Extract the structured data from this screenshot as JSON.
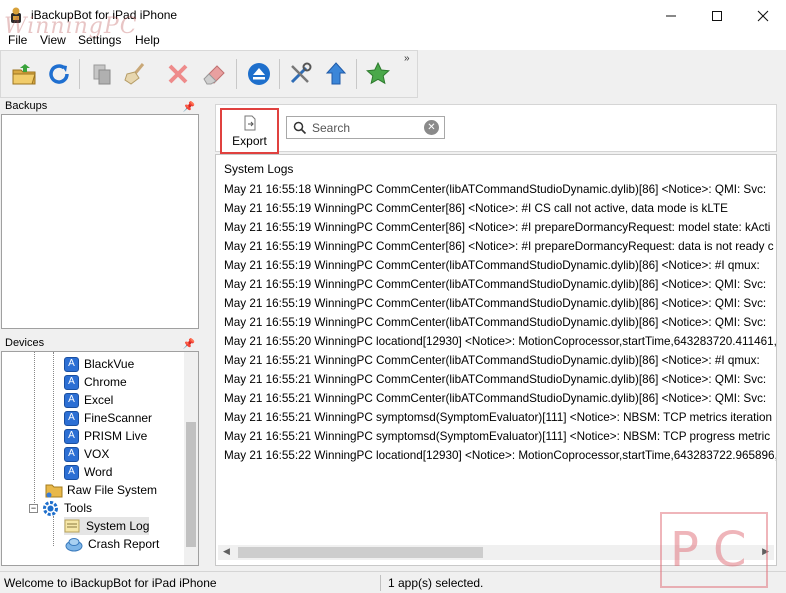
{
  "window": {
    "title": "iBackupBot for iPad iPhone"
  },
  "watermark": {
    "top": "WinningPC",
    "corner": "PC"
  },
  "menu": [
    "File",
    "View",
    "Settings",
    "Help"
  ],
  "toolbar": {
    "buttons": [
      "open-folder-icon",
      "refresh-icon",
      "copy-icon",
      "clean-icon",
      "delete-icon",
      "eraser-icon",
      "eject-icon",
      "tools-icon",
      "upload-icon",
      "star-icon"
    ],
    "overflow": "»"
  },
  "backups": {
    "header": "Backups"
  },
  "devices": {
    "header": "Devices",
    "apps": [
      "BlackVue",
      "Chrome",
      "Excel",
      "FineScanner",
      "PRISM Live",
      "VOX",
      "Word"
    ],
    "raw_file_system": "Raw File System",
    "tools": "Tools",
    "system_log": "System Log",
    "crash_report": "Crash Report"
  },
  "content": {
    "export_label": "Export",
    "search_placeholder": "Search",
    "logs_title": "System Logs",
    "logs": [
      "May 21 16:55:18 WinningPC CommCenter(libATCommandStudioDynamic.dylib)[86] <Notice>: QMI: Svc:",
      "May 21 16:55:19 WinningPC CommCenter[86] <Notice>: #I CS call not active, data mode is kLTE",
      "May 21 16:55:19 WinningPC CommCenter[86] <Notice>: #I prepareDormancyRequest: model state: kActi",
      "May 21 16:55:19 WinningPC CommCenter[86] <Notice>: #I prepareDormancyRequest: data is not ready c",
      "May 21 16:55:19 WinningPC CommCenter(libATCommandStudioDynamic.dylib)[86] <Notice>: #I qmux:",
      "May 21 16:55:19 WinningPC CommCenter(libATCommandStudioDynamic.dylib)[86] <Notice>: QMI: Svc:",
      "May 21 16:55:19 WinningPC CommCenter(libATCommandStudioDynamic.dylib)[86] <Notice>: QMI: Svc:",
      "May 21 16:55:19 WinningPC CommCenter(libATCommandStudioDynamic.dylib)[86] <Notice>: QMI: Svc:",
      "May 21 16:55:20 WinningPC locationd[12930] <Notice>: MotionCoprocessor,startTime,643283720.411461,",
      "May 21 16:55:21 WinningPC CommCenter(libATCommandStudioDynamic.dylib)[86] <Notice>: #I qmux:",
      "May 21 16:55:21 WinningPC CommCenter(libATCommandStudioDynamic.dylib)[86] <Notice>: QMI: Svc:",
      "May 21 16:55:21 WinningPC CommCenter(libATCommandStudioDynamic.dylib)[86] <Notice>: QMI: Svc:",
      "May 21 16:55:21 WinningPC symptomsd(SymptomEvaluator)[111] <Notice>: NBSM: TCP metrics iteration",
      "May 21 16:55:21 WinningPC symptomsd(SymptomEvaluator)[111] <Notice>: NBSM: TCP progress metric",
      "May 21 16:55:22 WinningPC locationd[12930] <Notice>: MotionCoprocessor,startTime,643283722.965896,"
    ]
  },
  "status": {
    "left": "Welcome to iBackupBot for iPad iPhone",
    "right": "1 app(s) selected."
  },
  "colors": {
    "highlight": "#e0413f",
    "app_icon": "#2c6fd4"
  }
}
